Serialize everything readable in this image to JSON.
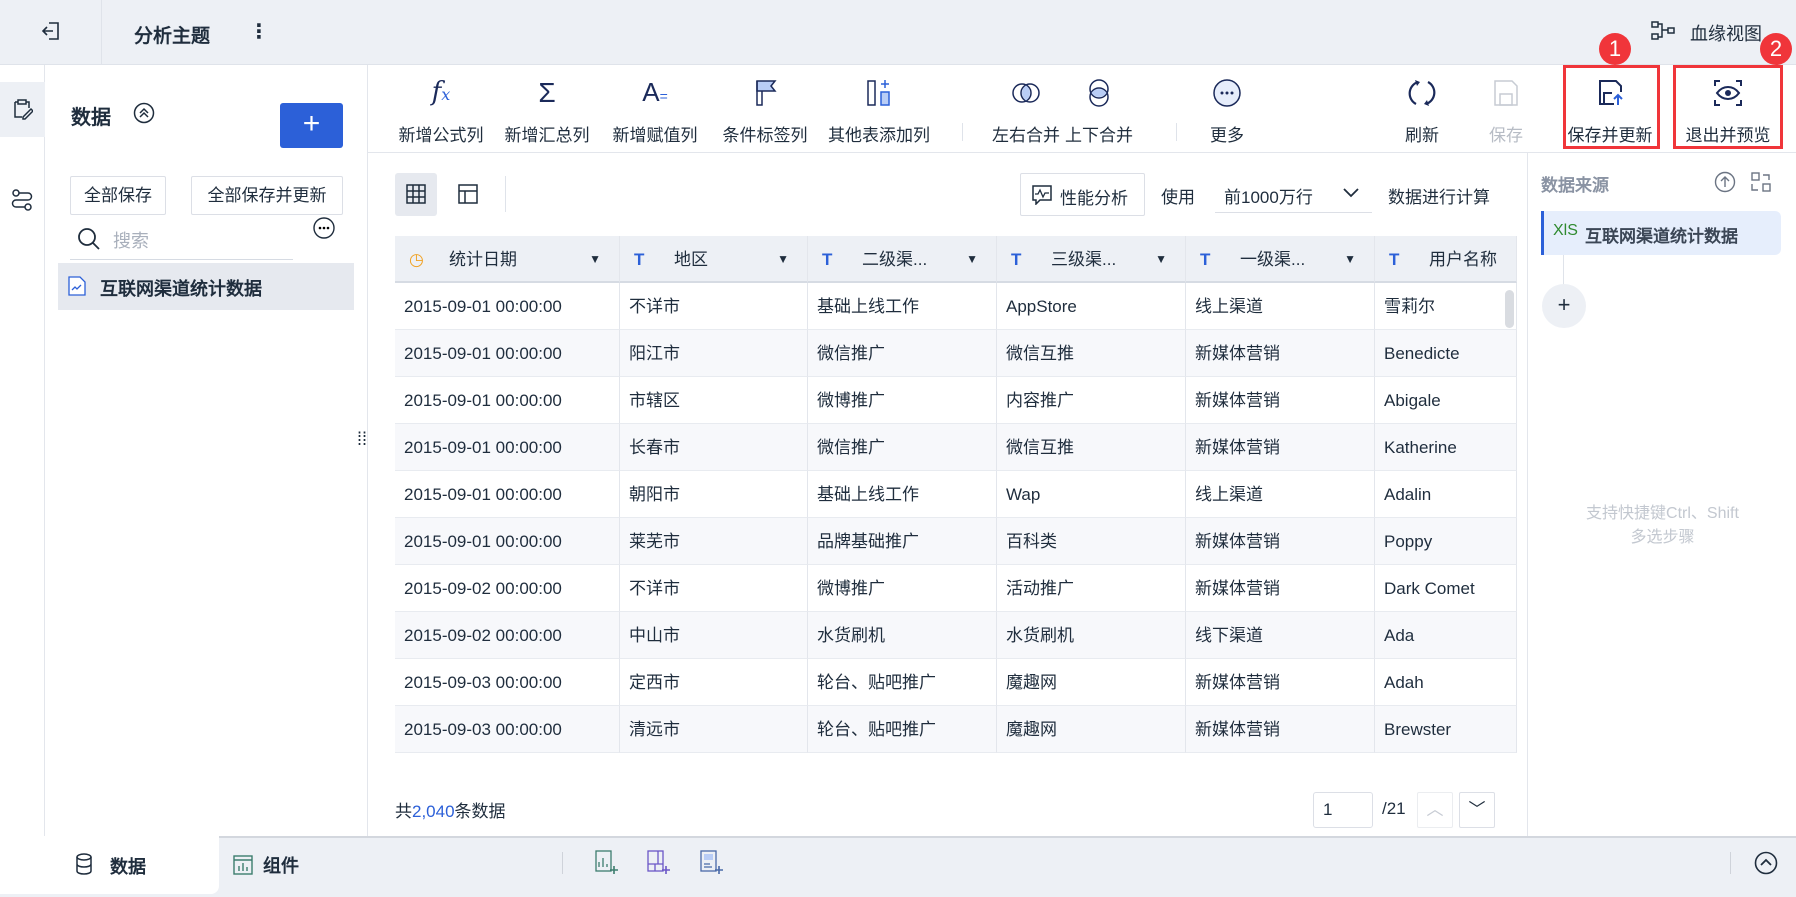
{
  "header": {
    "title": "分析主题",
    "lineage": "血缘视图"
  },
  "panel": {
    "title": "数据",
    "add": "+",
    "save_all": "全部保存",
    "save_all_update": "全部保存并更新",
    "search_placeholder": "搜索",
    "item": "互联网渠道统计数据"
  },
  "toolbar": {
    "items": [
      "新增公式列",
      "新增汇总列",
      "新增赋值列",
      "条件标签列",
      "其他表添加列",
      "左右合并",
      "上下合并",
      "更多",
      "刷新",
      "保存",
      "保存并更新",
      "退出并预览"
    ],
    "badges": [
      "1",
      "2"
    ]
  },
  "subbar": {
    "perf": "性能分析",
    "use": "使用",
    "rows_select": "前1000万行",
    "calc": "数据进行计算"
  },
  "table": {
    "headers": [
      "统计日期",
      "地区",
      "二级渠...",
      "三级渠...",
      "一级渠...",
      "用户名称"
    ],
    "rows": [
      [
        "2015-09-01 00:00:00",
        "不详市",
        "基础上线工作",
        "AppStore",
        "线上渠道",
        "雪莉尔"
      ],
      [
        "2015-09-01 00:00:00",
        "阳江市",
        "微信推广",
        "微信互推",
        "新媒体营销",
        "Benedicte"
      ],
      [
        "2015-09-01 00:00:00",
        "市辖区",
        "微博推广",
        "内容推广",
        "新媒体营销",
        "Abigale"
      ],
      [
        "2015-09-01 00:00:00",
        "长春市",
        "微信推广",
        "微信互推",
        "新媒体营销",
        "Katherine"
      ],
      [
        "2015-09-01 00:00:00",
        "朝阳市",
        "基础上线工作",
        "Wap",
        "线上渠道",
        "Adalin"
      ],
      [
        "2015-09-01 00:00:00",
        "莱芜市",
        "品牌基础推广",
        "百科类",
        "新媒体营销",
        "Poppy"
      ],
      [
        "2015-09-02 00:00:00",
        "不详市",
        "微博推广",
        "活动推广",
        "新媒体营销",
        "Dark Comet"
      ],
      [
        "2015-09-02 00:00:00",
        "中山市",
        "水货刷机",
        "水货刷机",
        "线下渠道",
        "Ada"
      ],
      [
        "2015-09-03 00:00:00",
        "定西市",
        "轮台、贴吧推广",
        "魔趣网",
        "新媒体营销",
        "Adah"
      ],
      [
        "2015-09-03 00:00:00",
        "清远市",
        "轮台、贴吧推广",
        "魔趣网",
        "新媒体营销",
        "Brewster"
      ]
    ]
  },
  "footer": {
    "prefix": "共",
    "count": "2,040",
    "suffix": "条数据",
    "page": "1",
    "total": "/21"
  },
  "right": {
    "title": "数据来源",
    "source_tag": "XlS",
    "source": "互联网渠道统计数据",
    "hint1": "支持快捷键Ctrl、Shift",
    "hint2": "多选步骤"
  },
  "bottom": {
    "tab_data": "数据",
    "tab_component": "组件"
  },
  "colors": {
    "accent": "#2c60d8",
    "red": "#f0353a"
  }
}
